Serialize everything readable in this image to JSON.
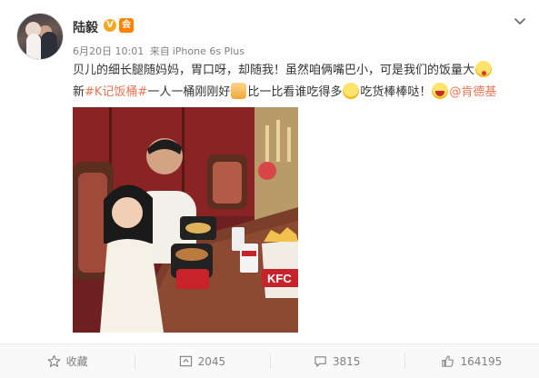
{
  "post": {
    "author": "陆毅",
    "verified_badge": "V",
    "member_badge": "会",
    "date": "6月20日 10:01",
    "source_prefix": "来自",
    "source": "iPhone 6s Plus",
    "line1": "贝儿的细长腿随妈妈，胃口呀，却随我！虽然咱俩嘴巴小，可是我们的饭量大",
    "line2_prefix": "新",
    "hashtag": "#K记饭桶#",
    "line2_mid": "一人一桶刚刚好",
    "line2_after_thumb": "比一比看谁吃得多",
    "line2_after_think": "吃货棒棒哒！",
    "mention": "@肯德基"
  },
  "photo": {
    "bucket_text": "KFC"
  },
  "actions": {
    "favorite_label": "收藏",
    "repost_count": "2045",
    "comment_count": "3815",
    "like_count": "164195"
  },
  "colors": {
    "link": "#eb7350",
    "muted": "#808080",
    "badge": "#f5a623"
  },
  "icons": [
    "chevron-down-icon",
    "favorite-icon",
    "repost-icon",
    "comment-icon",
    "like-icon"
  ]
}
